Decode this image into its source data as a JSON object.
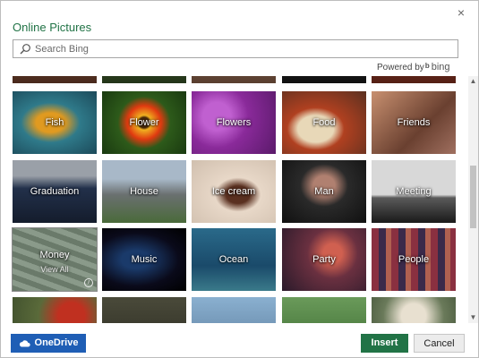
{
  "dialog": {
    "title": "Online Pictures",
    "close_glyph": "×"
  },
  "search": {
    "placeholder": "Search Bing",
    "value": ""
  },
  "powered_by": {
    "text": "Powered by",
    "brand": "bing"
  },
  "categories": [
    {
      "label": "",
      "sublabel": ""
    },
    {
      "label": "",
      "sublabel": ""
    },
    {
      "label": "",
      "sublabel": ""
    },
    {
      "label": "",
      "sublabel": ""
    },
    {
      "label": "",
      "sublabel": ""
    },
    {
      "label": "Fish",
      "sublabel": ""
    },
    {
      "label": "Flower",
      "sublabel": ""
    },
    {
      "label": "Flowers",
      "sublabel": ""
    },
    {
      "label": "Food",
      "sublabel": ""
    },
    {
      "label": "Friends",
      "sublabel": ""
    },
    {
      "label": "Graduation",
      "sublabel": ""
    },
    {
      "label": "House",
      "sublabel": ""
    },
    {
      "label": "Ice cream",
      "sublabel": ""
    },
    {
      "label": "Man",
      "sublabel": ""
    },
    {
      "label": "Meeting",
      "sublabel": ""
    },
    {
      "label": "Money",
      "sublabel": "View All"
    },
    {
      "label": "Music",
      "sublabel": ""
    },
    {
      "label": "Ocean",
      "sublabel": ""
    },
    {
      "label": "Party",
      "sublabel": ""
    },
    {
      "label": "People",
      "sublabel": ""
    },
    {
      "label": "",
      "sublabel": ""
    },
    {
      "label": "",
      "sublabel": ""
    },
    {
      "label": "",
      "sublabel": ""
    },
    {
      "label": "",
      "sublabel": ""
    },
    {
      "label": "",
      "sublabel": ""
    }
  ],
  "footer": {
    "onedrive_label": "OneDrive",
    "insert_label": "Insert",
    "cancel_label": "Cancel"
  },
  "colors": {
    "accent_green": "#217346",
    "onedrive_blue": "#1f5eb5"
  }
}
